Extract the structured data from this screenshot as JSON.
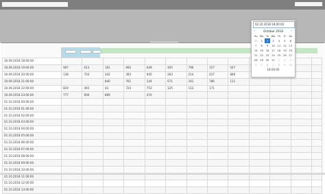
{
  "datepicker": {
    "input_value": "02.10.2018 18:00:00",
    "month_label": "October 2018",
    "prev": "‹",
    "next": "›",
    "weekdays": [
      "Su",
      "Mo",
      "Tu",
      "We",
      "Th",
      "Fr",
      "Sa"
    ],
    "weeks": [
      [
        "30",
        "1",
        "2",
        "3",
        "4",
        "5",
        "6"
      ],
      [
        "7",
        "8",
        "9",
        "10",
        "11",
        "12",
        "13"
      ],
      [
        "14",
        "15",
        "16",
        "17",
        "18",
        "19",
        "20"
      ],
      [
        "21",
        "22",
        "23",
        "24",
        "25",
        "26",
        "27"
      ],
      [
        "28",
        "29",
        "30",
        "31",
        "1",
        "2",
        "3"
      ],
      [
        "4",
        "5",
        "6",
        "7",
        "8",
        "9",
        "10"
      ]
    ],
    "selected": "2",
    "time": "18:00:00"
  },
  "table": {
    "rows": [
      {
        "ts": "30.09.2018 18:00:00",
        "v": [
          "",
          "",
          "",
          "",
          "",
          "",
          "",
          "",
          "",
          "",
          "",
          "",
          "",
          "",
          "",
          ""
        ]
      },
      {
        "ts": "30.09.2018 19:00:00",
        "v": [
          "907",
          "613",
          "181",
          "692",
          "649",
          "405",
          "790",
          "157",
          "547",
          "156",
          "",
          "",
          "",
          "",
          "",
          ""
        ]
      },
      {
        "ts": "30.09.2018 20:00:00",
        "v": [
          "138",
          "703",
          "342",
          "393",
          "945",
          "263",
          "214",
          "437",
          "846",
          "360",
          "",
          "",
          "",
          "",
          "",
          ""
        ]
      },
      {
        "ts": "30.09.2018 21:00:00",
        "v": [
          "",
          "",
          "840",
          "761",
          "144",
          "671",
          "161",
          "786",
          "111",
          "",
          "",
          "",
          "",
          "",
          "",
          ""
        ]
      },
      {
        "ts": "30.09.2018 22:00:00",
        "v": [
          "819",
          "465",
          "43",
          "724",
          "752",
          "125",
          "113",
          "171",
          "",
          "",
          "",
          "",
          "",
          "",
          "",
          ""
        ]
      },
      {
        "ts": "30.09.2018 23:00:00",
        "v": [
          "777",
          "906",
          "889",
          "",
          "470",
          "",
          "",
          "",
          "",
          "",
          "",
          "",
          "",
          "",
          "",
          ""
        ]
      },
      {
        "ts": "01.10.2018 00:00:00",
        "v": [
          "",
          "",
          "",
          "",
          "",
          "",
          "",
          "",
          "",
          "",
          "",
          "",
          "",
          "",
          "",
          ""
        ]
      },
      {
        "ts": "01.10.2018 01:00:00",
        "v": [
          "",
          "",
          "",
          "",
          "",
          "",
          "",
          "",
          "",
          "",
          "",
          "",
          "",
          "",
          "",
          ""
        ]
      },
      {
        "ts": "01.10.2018 02:00:00",
        "v": [
          "",
          "",
          "",
          "",
          "",
          "",
          "",
          "",
          "",
          "",
          "",
          "",
          "",
          "",
          "",
          ""
        ]
      },
      {
        "ts": "01.10.2018 03:00:00",
        "v": [
          "",
          "",
          "",
          "",
          "",
          "",
          "",
          "",
          "",
          "",
          "",
          "",
          "",
          "",
          "",
          ""
        ]
      },
      {
        "ts": "01.10.2018 04:00:00",
        "v": [
          "",
          "",
          "",
          "",
          "",
          "",
          "",
          "",
          "",
          "",
          "",
          "",
          "",
          "",
          "",
          ""
        ]
      },
      {
        "ts": "01.10.2018 05:00:00",
        "v": [
          "",
          "",
          "",
          "",
          "",
          "",
          "",
          "",
          "",
          "",
          "",
          "",
          "",
          "",
          "",
          ""
        ]
      },
      {
        "ts": "01.10.2018 06:00:00",
        "v": [
          "",
          "",
          "",
          "",
          "",
          "",
          "",
          "",
          "",
          "",
          "",
          "",
          "",
          "",
          "",
          ""
        ]
      },
      {
        "ts": "01.10.2018 07:00:00",
        "v": [
          "",
          "",
          "",
          "",
          "",
          "",
          "",
          "",
          "",
          "",
          "",
          "",
          "",
          "",
          "",
          ""
        ]
      },
      {
        "ts": "01.10.2018 08:00:00",
        "v": [
          "",
          "",
          "",
          "",
          "",
          "",
          "",
          "",
          "",
          "",
          "",
          "",
          "",
          "",
          "",
          ""
        ]
      },
      {
        "ts": "01.10.2018 09:00:00",
        "v": [
          "",
          "",
          "",
          "",
          "",
          "",
          "",
          "",
          "",
          "",
          "",
          "",
          "",
          "",
          "",
          ""
        ]
      },
      {
        "ts": "01.10.2018 10:00:00",
        "v": [
          "",
          "",
          "",
          "",
          "",
          "",
          "",
          "",
          "",
          "",
          "",
          "",
          "",
          "",
          "",
          ""
        ]
      },
      {
        "ts": "01.10.2018 11:00:00",
        "v": [
          "",
          "",
          "",
          "",
          "",
          "",
          "",
          "",
          "",
          "",
          "",
          "",
          "",
          "",
          "",
          ""
        ]
      },
      {
        "ts": "01.10.2018 12:00:00",
        "v": [
          "",
          "",
          "",
          "",
          "",
          "",
          "",
          "",
          "",
          "",
          "",
          "",
          "",
          "",
          "",
          ""
        ]
      },
      {
        "ts": "01.10.2018 13:00:00",
        "v": [
          "",
          "",
          "",
          "",
          "",
          "",
          "",
          "",
          "",
          "",
          "",
          "",
          "",
          "",
          "",
          ""
        ]
      }
    ]
  }
}
